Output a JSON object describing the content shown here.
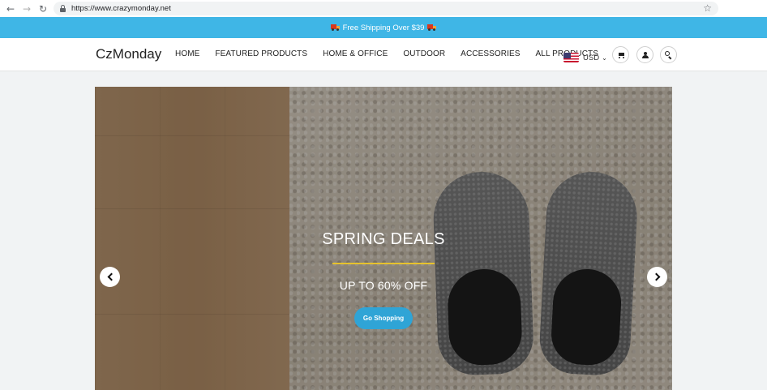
{
  "browser": {
    "url": "https://www.crazymonday.net"
  },
  "promo": {
    "text": "Free Shipping Over $39"
  },
  "header": {
    "logo": "CzMonday",
    "menu": [
      "HOME",
      "FEATURED PRODUCTS",
      "HOME & OFFICE",
      "OUTDOOR",
      "ACCESSORIES",
      "ALL PRODUCTS"
    ],
    "currency": "USD"
  },
  "hero": {
    "title": "SPRING DEALS",
    "subtitle": "UP TO 60% OFF",
    "button_label": "Go Shopping",
    "accent_color": "#e6c22d",
    "button_color": "#2fa4d6"
  },
  "colors": {
    "promo_bar": "#3fb6e6"
  },
  "icons": [
    "back-icon",
    "forward-icon",
    "reload-icon",
    "lock-icon",
    "star-icon",
    "truck-icon",
    "us-flag-icon",
    "cart-icon",
    "user-icon",
    "search-icon",
    "chevron-left-icon",
    "chevron-right-icon"
  ]
}
